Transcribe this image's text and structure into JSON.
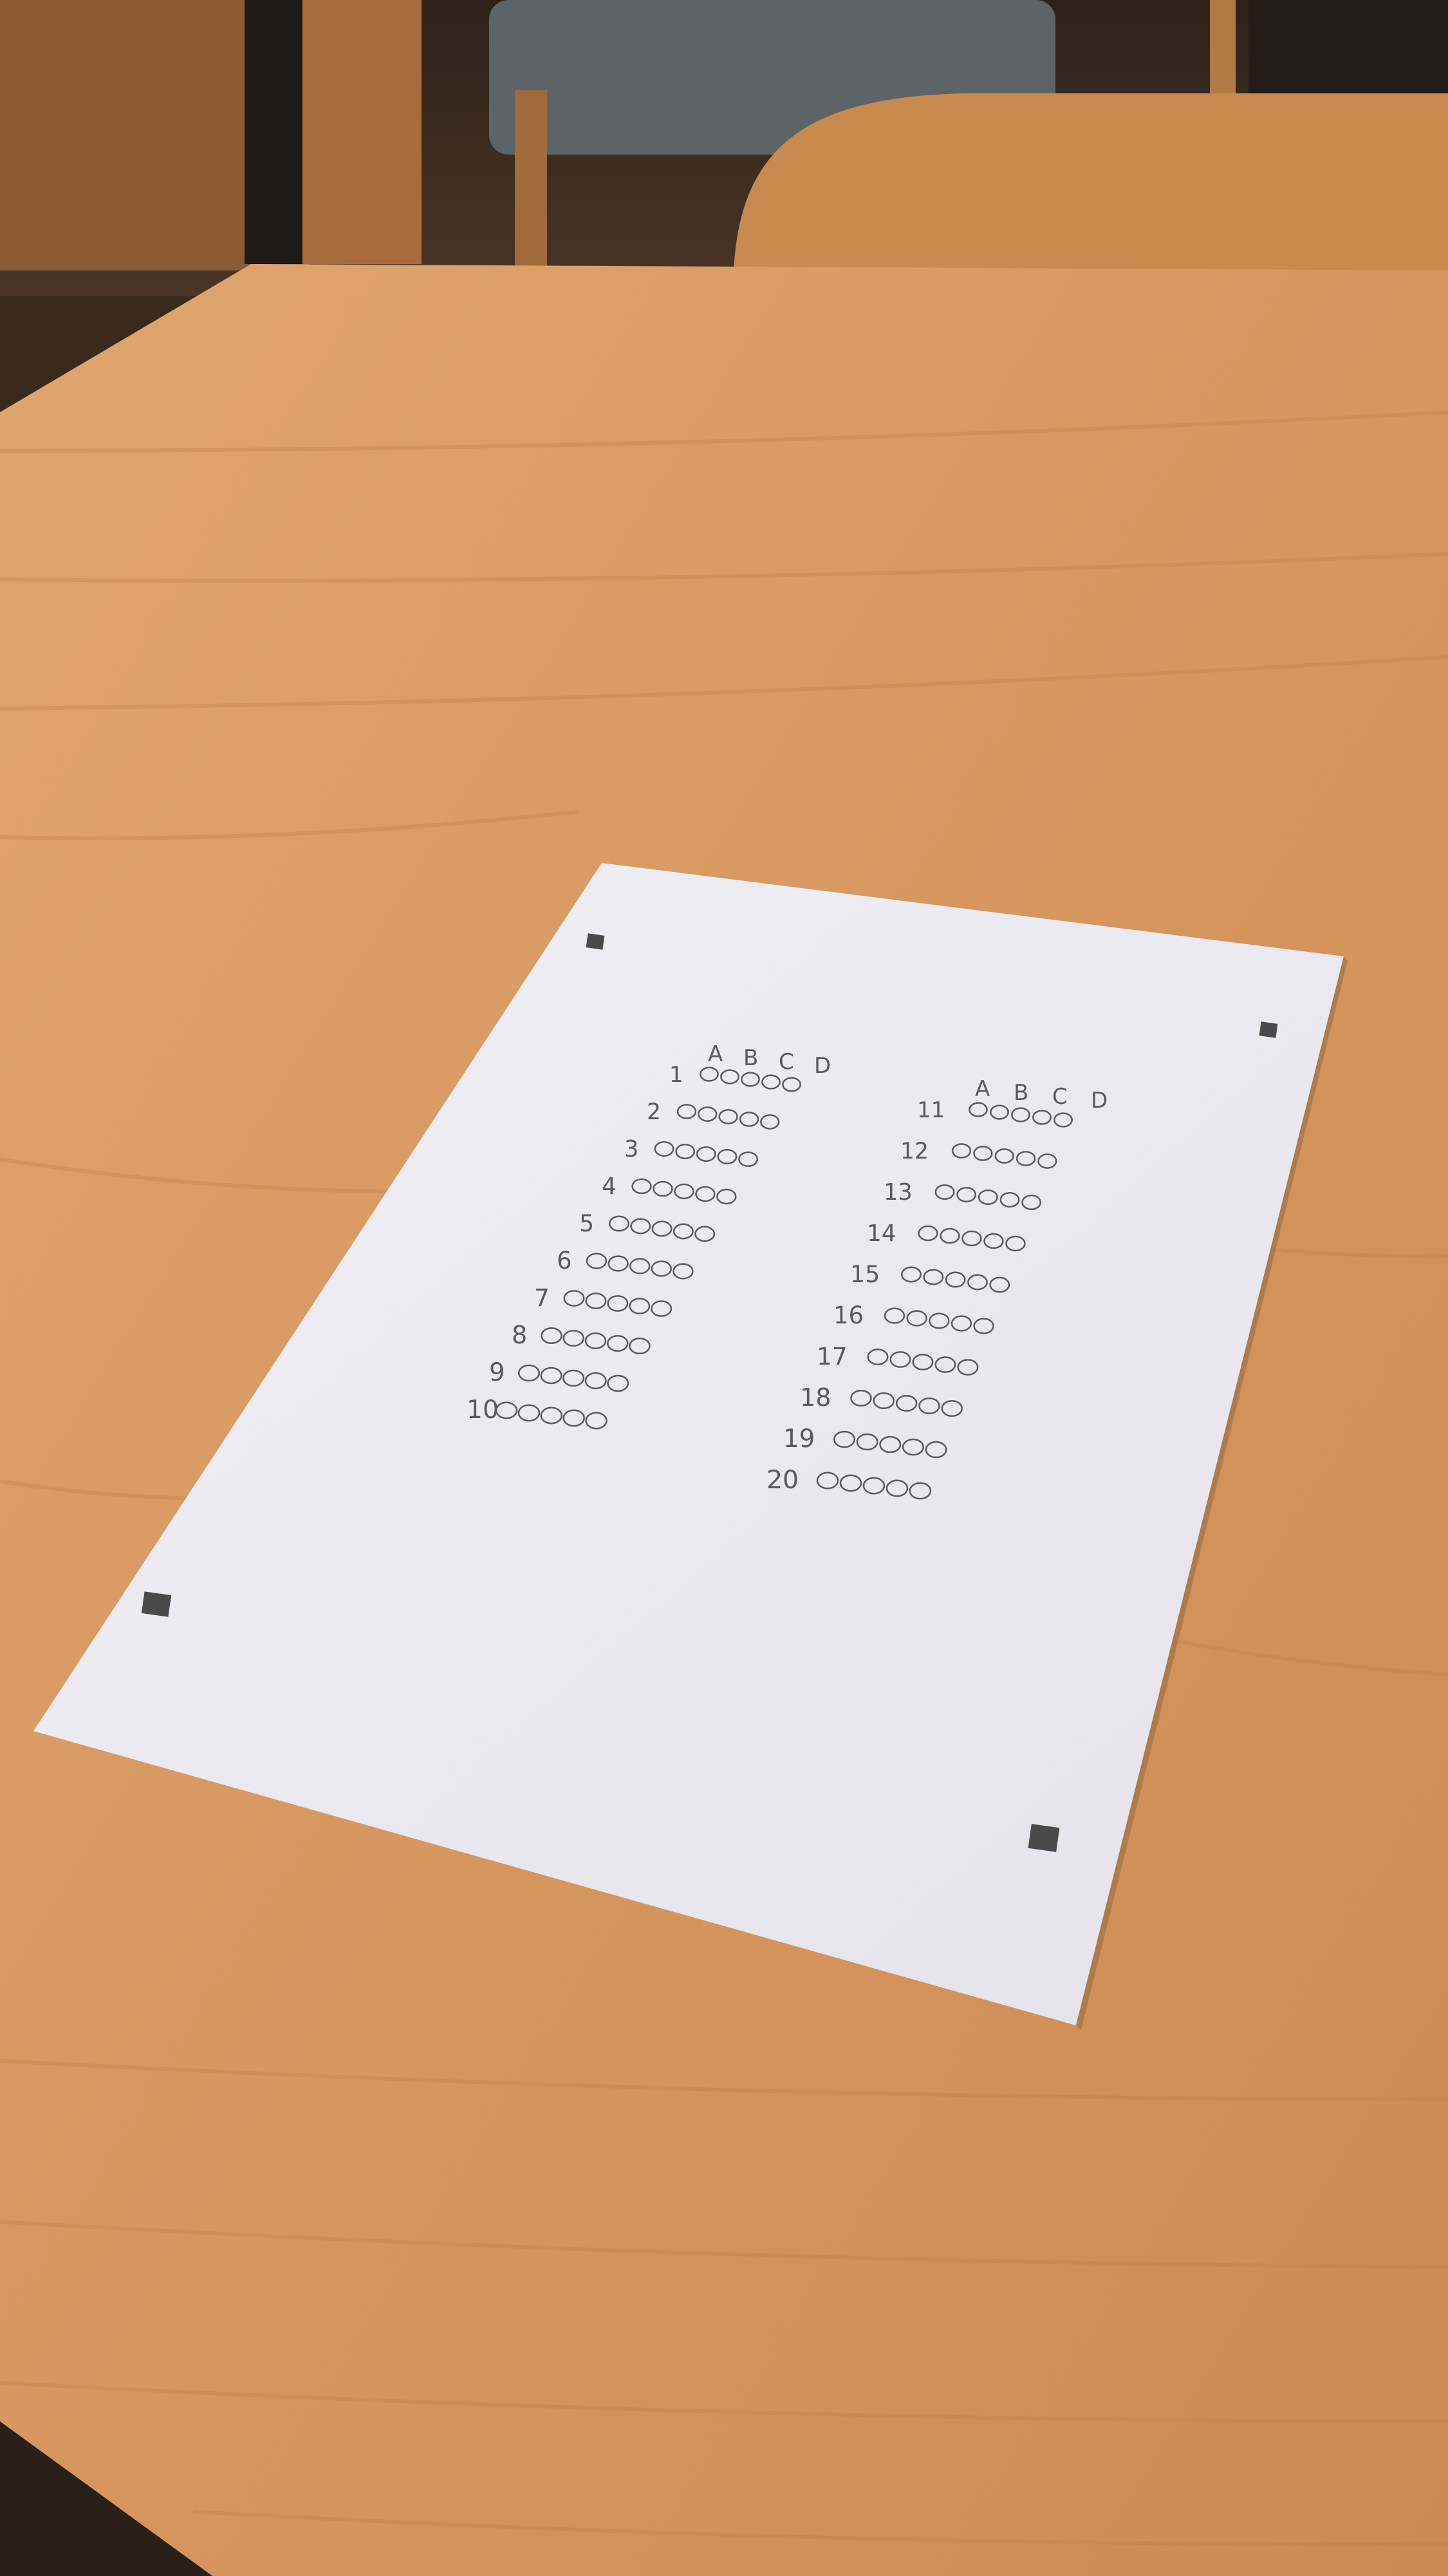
{
  "scene": {
    "description_tag": "photo",
    "colors": {
      "table": "#d99a63",
      "table_dark": "#b9743f",
      "paper": "#eceaf2",
      "ink": "#5a5a5a",
      "marker": "#4a4a4a",
      "chair": "#c88a50",
      "background": "#3a2a1c"
    }
  },
  "answer_sheet": {
    "header_letters": [
      "A",
      "B",
      "C",
      "D"
    ],
    "left_column": {
      "questions": [
        "1",
        "2",
        "3",
        "4",
        "5",
        "6",
        "7",
        "8",
        "9",
        "10"
      ]
    },
    "right_column": {
      "questions": [
        "11",
        "12",
        "13",
        "14",
        "15",
        "16",
        "17",
        "18",
        "19",
        "20"
      ]
    },
    "bubbles_per_question": 5
  }
}
